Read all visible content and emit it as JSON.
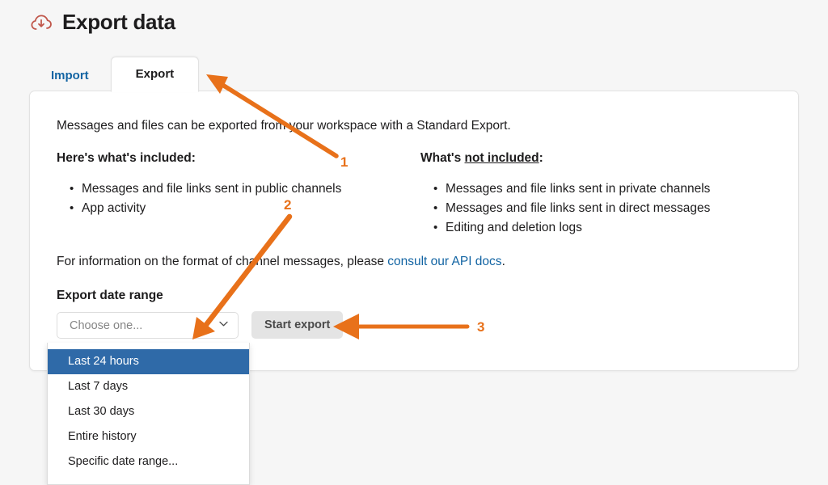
{
  "header": {
    "title": "Export data",
    "icon": "cloud-download-icon",
    "icon_color": "#c0564a"
  },
  "tabs": [
    {
      "label": "Import",
      "active": false
    },
    {
      "label": "Export",
      "active": true
    }
  ],
  "card": {
    "intro": "Messages and files can be exported from your workspace with a Standard Export.",
    "included": {
      "heading": "Here's what's included:",
      "items": [
        "Messages and file links sent in public channels",
        "App activity"
      ]
    },
    "not_included": {
      "heading_prefix": "What's ",
      "heading_underlined": "not included",
      "heading_suffix": ":",
      "items": [
        "Messages and file links sent in private channels",
        "Messages and file links sent in direct messages",
        "Editing and deletion logs"
      ]
    },
    "api_note": {
      "text_before": "For information on the format of channel messages, please ",
      "link_text": "consult our API docs",
      "text_after": "."
    },
    "date_range_label": "Export date range",
    "select": {
      "placeholder": "Choose one...",
      "value": "",
      "chevron": "chevron-down-icon",
      "options": [
        "Last 24 hours",
        "Last 7 days",
        "Last 30 days",
        "Entire history",
        "Specific date range..."
      ],
      "highlighted_option": "Last 24 hours"
    },
    "start_export_label": "Start export"
  },
  "annotations": {
    "color": "#e8711a",
    "markers": [
      {
        "number": "1",
        "points_to": "export-tab"
      },
      {
        "number": "2",
        "points_to": "date-range-select"
      },
      {
        "number": "3",
        "points_to": "start-export-button"
      }
    ]
  },
  "colors": {
    "page_background": "#f6f6f6",
    "card_background": "#ffffff",
    "link_blue": "#1264a3",
    "dropdown_highlight": "#2f6aa8",
    "annotation_orange": "#e8711a"
  }
}
